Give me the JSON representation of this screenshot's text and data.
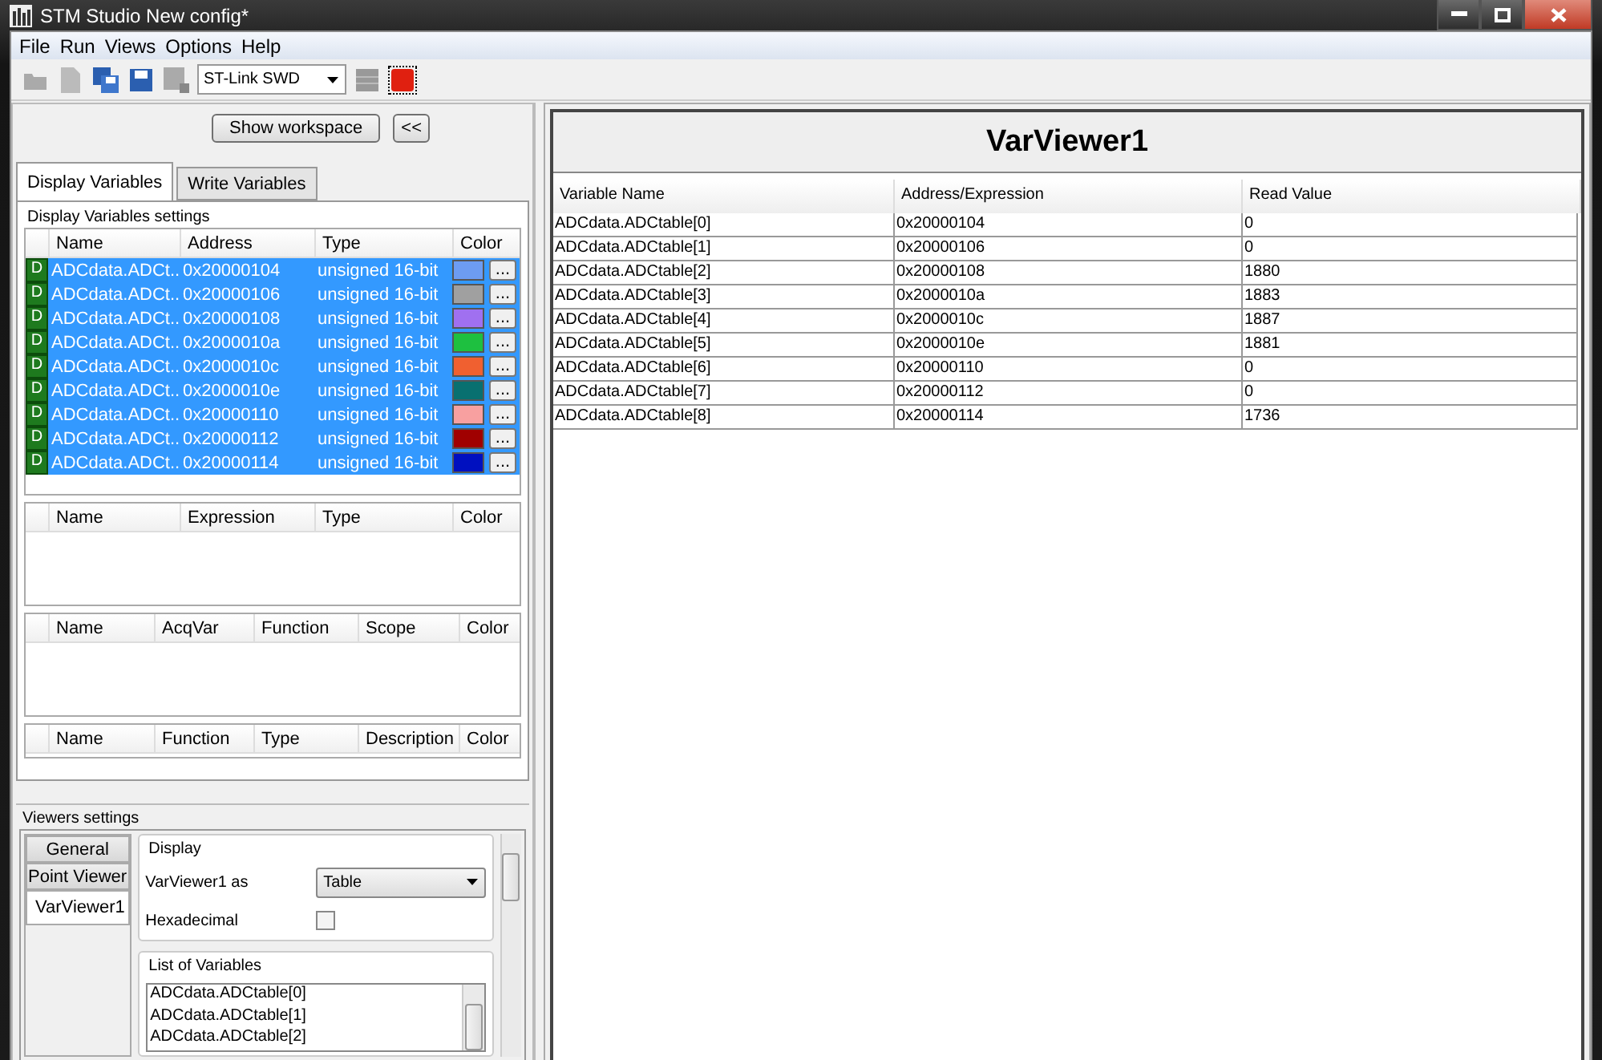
{
  "window": {
    "title": "STM Studio New config*"
  },
  "menu": [
    "File",
    "Run",
    "Views",
    "Options",
    "Help"
  ],
  "toolbar": {
    "connection": "ST-Link SWD"
  },
  "workspace": {
    "show_button": "Show workspace",
    "collapse_button": "<<"
  },
  "tabs": [
    {
      "label": "Display Variables",
      "selected": true
    },
    {
      "label": "Write Variables",
      "selected": false
    }
  ],
  "display_settings": {
    "title": "Display Variables settings",
    "variables_table": {
      "columns": [
        "Name",
        "Address",
        "Type",
        "Color"
      ],
      "rows": [
        {
          "badge": "D",
          "name": "ADCdata.ADCt...",
          "address": "0x20000104",
          "type": "unsigned 16-bit",
          "color": "#6d9cf2",
          "button": "...",
          "selected": true
        },
        {
          "badge": "D",
          "name": "ADCdata.ADCt...",
          "address": "0x20000106",
          "type": "unsigned 16-bit",
          "color": "#a0a0a0",
          "button": "...",
          "selected": true
        },
        {
          "badge": "D",
          "name": "ADCdata.ADCt...",
          "address": "0x20000108",
          "type": "unsigned 16-bit",
          "color": "#a070f0",
          "button": "...",
          "selected": true
        },
        {
          "badge": "D",
          "name": "ADCdata.ADCt...",
          "address": "0x2000010a",
          "type": "unsigned 16-bit",
          "color": "#1ec040",
          "button": "...",
          "selected": true
        },
        {
          "badge": "D",
          "name": "ADCdata.ADCt...",
          "address": "0x2000010c",
          "type": "unsigned 16-bit",
          "color": "#f06030",
          "button": "...",
          "selected": true
        },
        {
          "badge": "D",
          "name": "ADCdata.ADCt...",
          "address": "0x2000010e",
          "type": "unsigned 16-bit",
          "color": "#087070",
          "button": "...",
          "selected": true
        },
        {
          "badge": "D",
          "name": "ADCdata.ADCt...",
          "address": "0x20000110",
          "type": "unsigned 16-bit",
          "color": "#f8a0a0",
          "button": "...",
          "selected": true
        },
        {
          "badge": "D",
          "name": "ADCdata.ADCt...",
          "address": "0x20000112",
          "type": "unsigned 16-bit",
          "color": "#a00000",
          "button": "...",
          "selected": true
        },
        {
          "badge": "D",
          "name": "ADCdata.ADCt...",
          "address": "0x20000114",
          "type": "unsigned 16-bit",
          "color": "#0010c0",
          "button": "...",
          "selected": true
        }
      ]
    },
    "other_tables": [
      {
        "columns": [
          "Name",
          "Expression",
          "Type",
          "Color"
        ]
      },
      {
        "columns": [
          "Name",
          "AcqVar",
          "Function",
          "Scope",
          "Color"
        ]
      },
      {
        "columns": [
          "Name",
          "Function",
          "Type",
          "Description",
          "Color"
        ]
      }
    ]
  },
  "viewers_settings": {
    "title": "Viewers settings",
    "viewer_tabs": [
      {
        "label": "General",
        "selected": false
      },
      {
        "label": "Point Viewer",
        "selected": false
      },
      {
        "label": "VarViewer1",
        "selected": true
      }
    ],
    "display_group": {
      "title": "Display",
      "view_as_label": "VarViewer1 as",
      "view_as_value": "Table",
      "hex_label": "Hexadecimal",
      "hex_checked": false
    },
    "variables_group": {
      "title": "List of Variables",
      "items": [
        "ADCdata.ADCtable[0]",
        "ADCdata.ADCtable[1]",
        "ADCdata.ADCtable[2]"
      ]
    }
  },
  "viewer": {
    "title": "VarViewer1",
    "columns": [
      "Variable Name",
      "Address/Expression",
      "Read Value"
    ],
    "rows": [
      [
        "ADCdata.ADCtable[0]",
        "0x20000104",
        "0"
      ],
      [
        "ADCdata.ADCtable[1]",
        "0x20000106",
        "0"
      ],
      [
        "ADCdata.ADCtable[2]",
        "0x20000108",
        "1880"
      ],
      [
        "ADCdata.ADCtable[3]",
        "0x2000010a",
        "1883"
      ],
      [
        "ADCdata.ADCtable[4]",
        "0x2000010c",
        "1887"
      ],
      [
        "ADCdata.ADCtable[5]",
        "0x2000010e",
        "1881"
      ],
      [
        "ADCdata.ADCtable[6]",
        "0x20000110",
        "0"
      ],
      [
        "ADCdata.ADCtable[7]",
        "0x20000112",
        "0"
      ],
      [
        "ADCdata.ADCtable[8]",
        "0x20000114",
        "1736"
      ]
    ]
  }
}
